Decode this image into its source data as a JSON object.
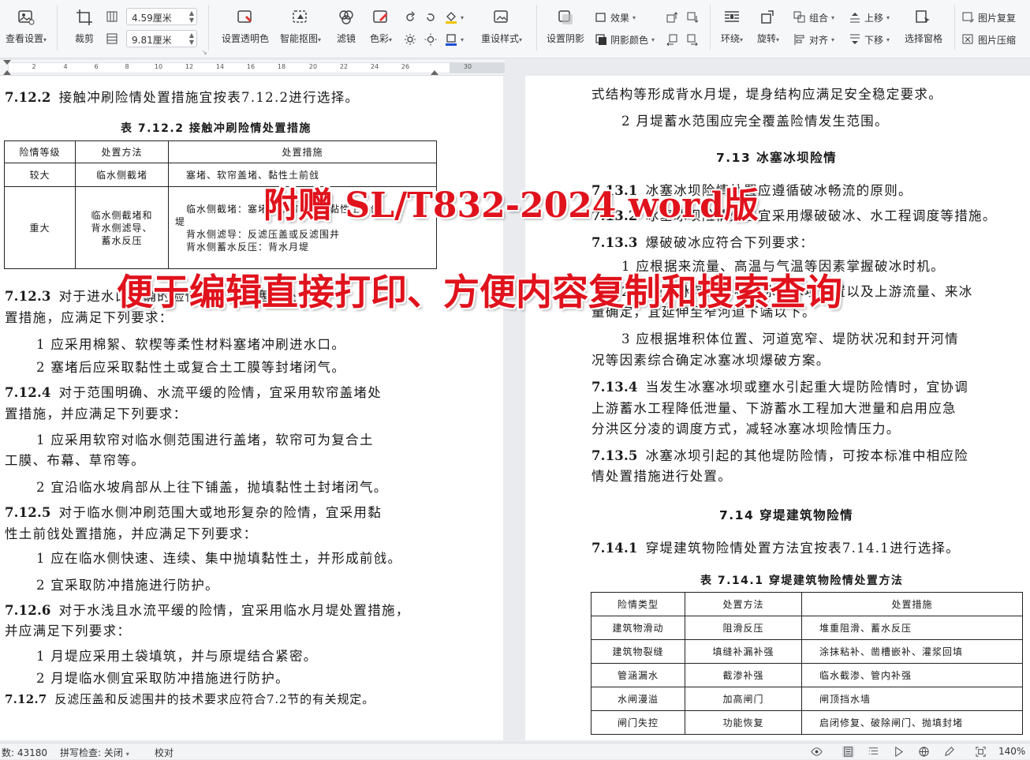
{
  "toolbar": {
    "view_settings": "查看设置",
    "crop": "裁剪",
    "width_value": "4.59厘米",
    "height_value": "9.81厘米",
    "set_transparent": "设置透明色",
    "smart_cutout": "智能抠图",
    "filter": "滤镜",
    "color": "色彩",
    "reset_style": "重设样式",
    "effects": "效果",
    "set_shadow": "设置阴影",
    "shadow_color": "阴影颜色",
    "wrap": "环绕",
    "rotate": "旋转",
    "group": "组合",
    "align": "对齐",
    "bring_forward": "上移",
    "send_backward": "下移",
    "selection_pane": "选择窗格",
    "image_restore": "图片复复",
    "image_compress": "图片压缩"
  },
  "ruler": {
    "ticks": [
      "2",
      "4",
      "6",
      "8",
      "10",
      "12",
      "14",
      "16",
      "18",
      "20",
      "22",
      "24",
      "26",
      "30"
    ]
  },
  "left_page": {
    "c7122": {
      "num": "7.12.2",
      "text": "接触冲刷险情处置措施宜按表7.12.2进行选择。"
    },
    "table_title": "表 7.12.2  接触冲刷险情处置措施",
    "table": {
      "headers": [
        "险情等级",
        "处置方法",
        "处置措施"
      ],
      "row1": [
        "较大",
        "临水侧截堵",
        "塞堵、软帘盖堵、黏性土前戗"
      ],
      "row2_level": "重大",
      "row2_method": [
        "临水侧截堵和",
        "背水侧滤导、",
        "蓄水反压"
      ],
      "row2_measures": [
        "临水侧截堵：塞堵、软帘盖堵、黏性土前戗",
        "堤",
        "背水侧滤导：反滤压盖或反滤围井",
        "背水侧蓄水反压：背水月堤"
      ]
    },
    "c7123": {
      "num": "7.12.3",
      "line1": "对于进水口明确的险情，宜采用塞堵处",
      "line2": "置措施，应满足下列要求："
    },
    "c7123_1": "1 应采用棉絮、软楔等柔性材料塞堵冲刷进水口。",
    "c7123_2": "2 塞堵后应采取黏性土或复合土工膜等封堵闭气。",
    "c7124": {
      "num": "7.12.4",
      "line1": "对于范围明确、水流平缓的险情，宜采用软帘盖堵处",
      "line2": "置措施，并应满足下列要求："
    },
    "c7124_1a": "1 应采用软帘对临水侧范围进行盖堵，软帘可为复合土",
    "c7124_1b": "工膜、布幕、草帘等。",
    "c7124_2": "2 宜沿临水坡肩部从上往下铺盖，抛填黏性土封堵闭气。",
    "c7125": {
      "num": "7.12.5",
      "line1": "对于临水侧冲刷范围大或地形复杂的险情，宜采用黏",
      "line2": "性土前戗处置措施，并应满足下列要求："
    },
    "c7125_1": "1 应在临水侧快速、连续、集中抛填黏性土，并形成前戗。",
    "c7125_2": "2 宜采取防冲措施进行防护。",
    "c7126": {
      "num": "7.12.6",
      "line1": "对于水浅且水流平缓的险情，宜采用临水月堤处置措施，",
      "line2": "并应满足下列要求："
    },
    "c7126_1": "1 月堤应采用土袋填筑，并与原堤结合紧密。",
    "c7126_2": "2 月堤临水侧宜采取防冲措施进行防护。",
    "c7127": {
      "num": "7.12.7",
      "text": "反滤压盖和反滤围井的技术要求应符合7.2节的有关规定。"
    }
  },
  "right_page": {
    "top1": "式结构等形成背水月堤，堤身结构应满足安全稳定要求。",
    "top2": "2 月堤蓄水范围应完全覆盖险情发生范围。",
    "sec713": "7.13  冰塞冰坝险情",
    "c7131": {
      "num": "7.13.1",
      "text": "冰塞冰坝险情处置应遵循破冰畅流的原则。"
    },
    "c7132": {
      "num": "7.13.2",
      "text": "冰塞冰坝险情处置宜采用爆破破冰、水工程调度等措施。"
    },
    "c7133": {
      "num": "7.13.3",
      "text": "爆破破冰应符合下列要求："
    },
    "c7133_1": "1 应根据来流量、高温与气温等因素掌握破冰时机。",
    "c7133_2a": "2 爆破破冰范围应根据冰塞冰坝位置以及上游流量、来冰",
    "c7133_2b": "量确定，宜延伸至窄河道下端以下。",
    "c7133_3a": "3 应根据堆积体位置、河道宽窄、堤防状况和封开河情",
    "c7133_3b": "况等因素综合确定冰塞冰坝爆破方案。",
    "c7134": {
      "num": "7.13.4",
      "line1": "当发生冰塞冰坝或壅水引起重大堤防险情时，宜协调",
      "line2": "上游蓄水工程降低泄量、下游蓄水工程加大泄量和启用应急",
      "line3": "分洪区分凌的调度方式，减轻冰塞冰坝险情压力。"
    },
    "c7135": {
      "num": "7.13.5",
      "line1": "冰塞冰坝引起的其他堤防险情，可按本标准中相应险",
      "line2": "情处置措施进行处置。"
    },
    "sec714": "7.14  穿堤建筑物险情",
    "c7141": {
      "num": "7.14.1",
      "text": "穿堤建筑物险情处置方法宜按表7.14.1进行选择。"
    },
    "table_title": "表 7.14.1  穿堤建筑物险情处置方法",
    "table": {
      "headers": [
        "险情类型",
        "处置方法",
        "处置措施"
      ],
      "rows": [
        [
          "建筑物滑动",
          "阻滑反压",
          "堆重阻滑、蓄水反压"
        ],
        [
          "建筑物裂缝",
          "填缝补漏补强",
          "涂抹粘补、凿槽嵌补、灌浆回填"
        ],
        [
          "管涵漏水",
          "截渗补强",
          "临水截渗、管内补强"
        ],
        [
          "水闸漫溢",
          "加高闸门",
          "闸顶挡水墙"
        ],
        [
          "闸门失控",
          "功能恢复",
          "启闭修复、破除闸门、抛填封堵"
        ]
      ]
    }
  },
  "watermark": {
    "line1": "附赠 SL/T832-2024 word版",
    "line2": "便于编辑直接打印、方便内容复制和搜索查询"
  },
  "statusbar": {
    "word_count": "数: 43180",
    "spell_check": "拼写检查: 关闭",
    "proofread": "校对",
    "zoom": "140%"
  }
}
